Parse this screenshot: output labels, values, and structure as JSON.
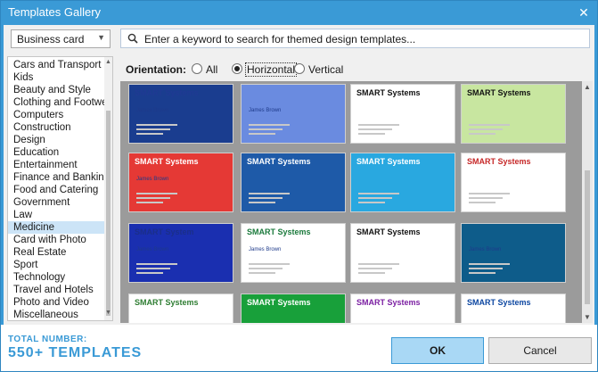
{
  "window": {
    "title": "Templates Gallery",
    "close_glyph": "✕"
  },
  "category_select": {
    "value": "Business card",
    "arrow": "▼"
  },
  "categories": [
    "Cars and Transport",
    "Kids",
    "Beauty and Style",
    "Clothing and Footwear",
    "Computers",
    "Construction",
    "Design",
    "Education",
    "Entertainment",
    "Finance and Banking",
    "Food and Catering",
    "Government",
    "Law",
    "Medicine",
    "Card with Photo",
    "Real Estate",
    "Sport",
    "Technology",
    "Travel and Hotels",
    "Photo and Video",
    "Miscellaneous"
  ],
  "selected_category": "Medicine",
  "search": {
    "placeholder": "Enter a keyword to search for themed design templates...",
    "icon": "search-icon"
  },
  "orientation": {
    "label": "Orientation:",
    "options": [
      "All",
      "Horizontal",
      "Vertical"
    ],
    "selected": "Horizontal"
  },
  "templates": [
    {
      "company": "SMART Systems",
      "person": "James Brown",
      "title_color": "#1f3a93",
      "accent": "#1a3d8f"
    },
    {
      "company": "",
      "person": "James Brown",
      "title_color": "#ffffff",
      "accent": "#6a8be0"
    },
    {
      "company": "SMART Systems",
      "person": "",
      "title_color": "#111111",
      "accent": "#ffffff"
    },
    {
      "company": "SMART Systems",
      "person": "",
      "title_color": "#111111",
      "accent": "#c8e6a0"
    },
    {
      "company": "SMART Systems",
      "person": "James Brown",
      "title_color": "#ffffff",
      "accent": "#e53935"
    },
    {
      "company": "SMART Systems",
      "person": "",
      "title_color": "#ffffff",
      "accent": "#1e5aa8"
    },
    {
      "company": "SMART Systems",
      "person": "",
      "title_color": "#ffffff",
      "accent": "#29a8e0"
    },
    {
      "company": "SMART Systems",
      "person": "",
      "title_color": "#c62828",
      "accent": "#ffffff"
    },
    {
      "company": "SMART System",
      "person": "James Brown",
      "title_color": "#1a2f8a",
      "accent": "#1a2fb0"
    },
    {
      "company": "SMART Systems",
      "person": "James Brown",
      "title_color": "#1b7a3c",
      "accent": "#ffffff"
    },
    {
      "company": "SMART Systems",
      "person": "",
      "title_color": "#111111",
      "accent": "#ffffff"
    },
    {
      "company": "",
      "person": "James Brown",
      "title_color": "#ffffff",
      "accent": "#0e5c8a"
    },
    {
      "company": "SMART Systems",
      "person": "",
      "title_color": "#2e7d32",
      "accent": "#ffffff"
    },
    {
      "company": "SMART Systems",
      "person": "",
      "title_color": "#ffffff",
      "accent": "#18a03a"
    },
    {
      "company": "SMART Systems",
      "person": "",
      "title_color": "#7b1fa2",
      "accent": "#ffffff"
    },
    {
      "company": "SMART Systems",
      "person": "",
      "title_color": "#0d47a1",
      "accent": "#ffffff"
    }
  ],
  "footer": {
    "total_label": "Total number:",
    "total_value": "550+ templates",
    "ok": "OK",
    "cancel": "Cancel"
  }
}
